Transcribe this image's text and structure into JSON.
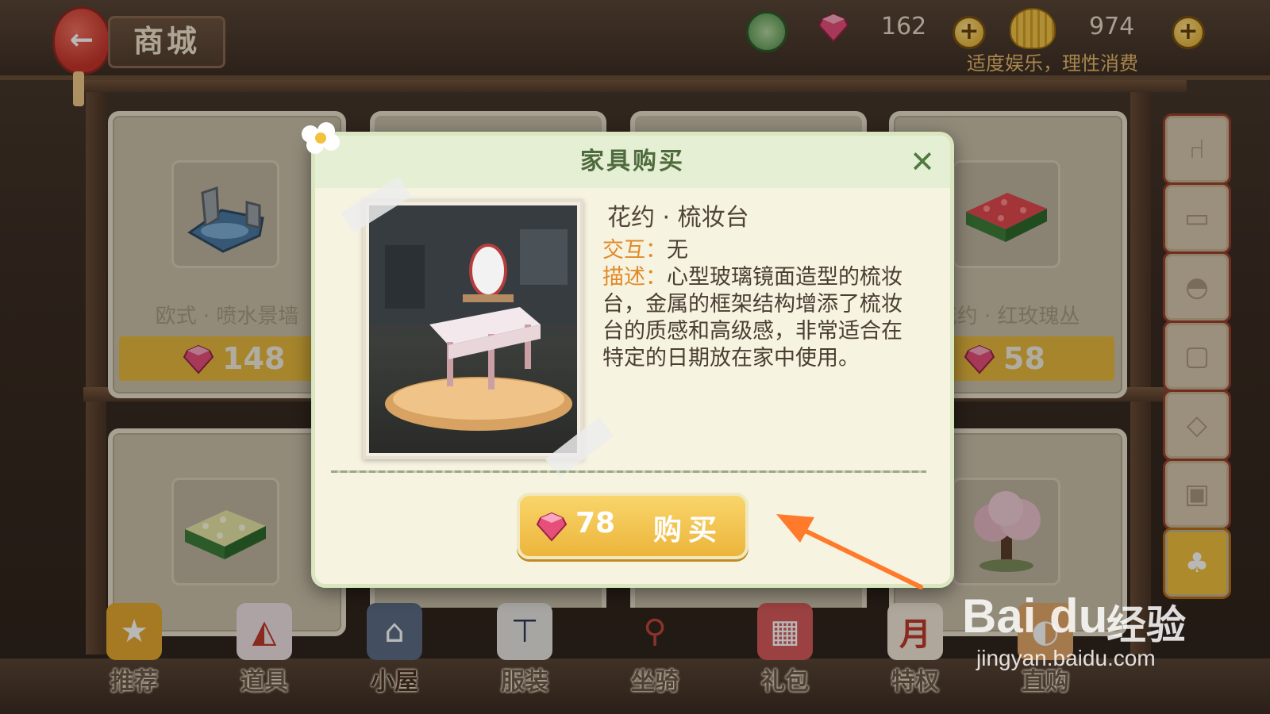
{
  "header": {
    "back_icon": "back-arrow-icon",
    "title": "商城",
    "gems": "162",
    "shells": "974",
    "notice": "适度娱乐，理性消费"
  },
  "shop_items": [
    {
      "name": "欧式 · 喷水景墙",
      "price": "148"
    },
    {
      "name": "花约 · 红玫瑰丛",
      "price": "58"
    }
  ],
  "side_tabs": [
    "chair-icon",
    "bed-icon",
    "fan-icon",
    "pillow-icon",
    "frame-icon",
    "box-icon",
    "plant-icon"
  ],
  "bottom_nav": [
    {
      "label": "推荐",
      "icon": "star-icon"
    },
    {
      "label": "道具",
      "icon": "fox-mask-icon"
    },
    {
      "label": "小屋",
      "icon": "house-icon",
      "active": true
    },
    {
      "label": "服装",
      "icon": "uniform-icon"
    },
    {
      "label": "坐骑",
      "icon": "bicycle-icon"
    },
    {
      "label": "礼包",
      "icon": "gift-icon"
    },
    {
      "label": "特权",
      "icon": "month-card-icon"
    },
    {
      "label": "直购",
      "icon": "shop-bag-icon"
    }
  ],
  "dialog": {
    "title": "家具购买",
    "item_name": "花约 · 梳妆台",
    "interaction_label": "交互：",
    "interaction_value": "无",
    "description_label": "描述：",
    "description_text": "心型玻璃镜面造型的梳妆台，金属的框架结构增添了梳妆台的质感和高级感，非常适合在特定的日期放在家中使用。",
    "price": "78",
    "buy_label": "购买"
  },
  "watermark": {
    "logo": "Bai du",
    "brand": "经验",
    "url": "jingyan.baidu.com"
  },
  "colors": {
    "gold_price_bar": "#e7b93d",
    "accent_orange": "#ff7a2a",
    "dialog_title_green": "#4f6b3d"
  }
}
